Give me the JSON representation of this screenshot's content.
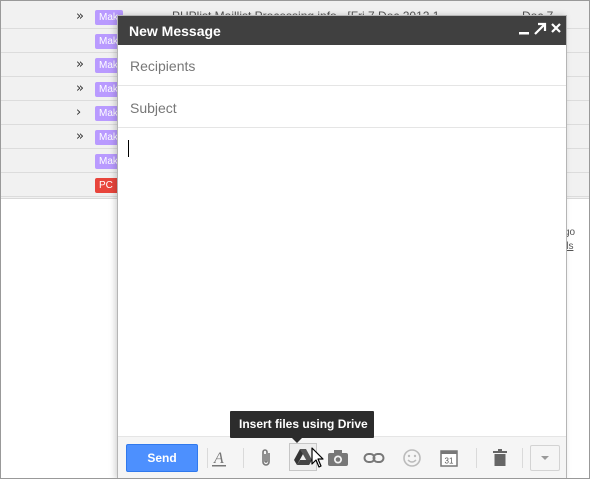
{
  "inbox": {
    "rows": [
      {
        "arrow": "»",
        "label": "Mak",
        "label_color": "#b99aff",
        "text": "PHPlist Maillist Processing info - [Fri 7 Dec 2012 1",
        "date": "Dec 7"
      },
      {
        "arrow": "",
        "label": "Mak",
        "label_color": "#b99aff",
        "text": "",
        "date": ""
      },
      {
        "arrow": "»",
        "label": "Mak",
        "label_color": "#b99aff",
        "text": "",
        "date": ""
      },
      {
        "arrow": "»",
        "label": "Mak",
        "label_color": "#b99aff",
        "text": "",
        "date": ""
      },
      {
        "arrow": "›",
        "label": "Mak",
        "label_color": "#b99aff",
        "text": "",
        "date": ""
      },
      {
        "arrow": "»",
        "label": "Mak",
        "label_color": "#b99aff",
        "text": "",
        "date": ""
      },
      {
        "arrow": "",
        "label": "Mak",
        "label_color": "#b99aff",
        "text": "",
        "date": ""
      },
      {
        "arrow": "",
        "label": "PC",
        "label_color": "#e8453c",
        "text": "",
        "date": ""
      }
    ],
    "side_text_1": "go",
    "side_text_2": "ils"
  },
  "compose": {
    "title": "New Message",
    "minimize_icon": "minimize-icon",
    "popout_icon": "popout-icon",
    "close_icon": "close-icon",
    "recipients_placeholder": "Recipients",
    "subject_placeholder": "Subject",
    "send_label": "Send",
    "tooltip": "Insert files using Drive",
    "tools": [
      "formatting-icon",
      "attach-icon",
      "drive-icon",
      "photo-icon",
      "link-icon",
      "emoji-icon",
      "calendar-icon",
      "trash-icon",
      "more-options-icon"
    ],
    "calendar_day": "31"
  }
}
